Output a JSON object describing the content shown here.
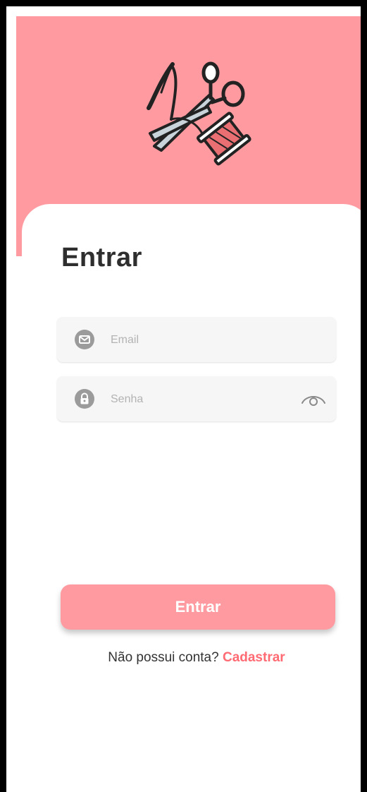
{
  "login": {
    "title": "Entrar",
    "email": {
      "placeholder": "Email",
      "value": ""
    },
    "password": {
      "placeholder": "Senha",
      "value": ""
    },
    "submit_label": "Entrar",
    "no_account_text": "Não possui conta?",
    "signup_link_label": "Cadastrar"
  },
  "icons": {
    "logo": "sewing-scissors-needle-thread-icon",
    "email": "envelope-icon",
    "password": "lock-icon",
    "toggle_visibility": "eye-icon"
  },
  "colors": {
    "header_bg": "#ff9aa0",
    "button_bg": "#ff9aa0",
    "link": "#ff6a73",
    "field_bg": "#f6f6f6",
    "title_text": "#2e2e2e"
  }
}
